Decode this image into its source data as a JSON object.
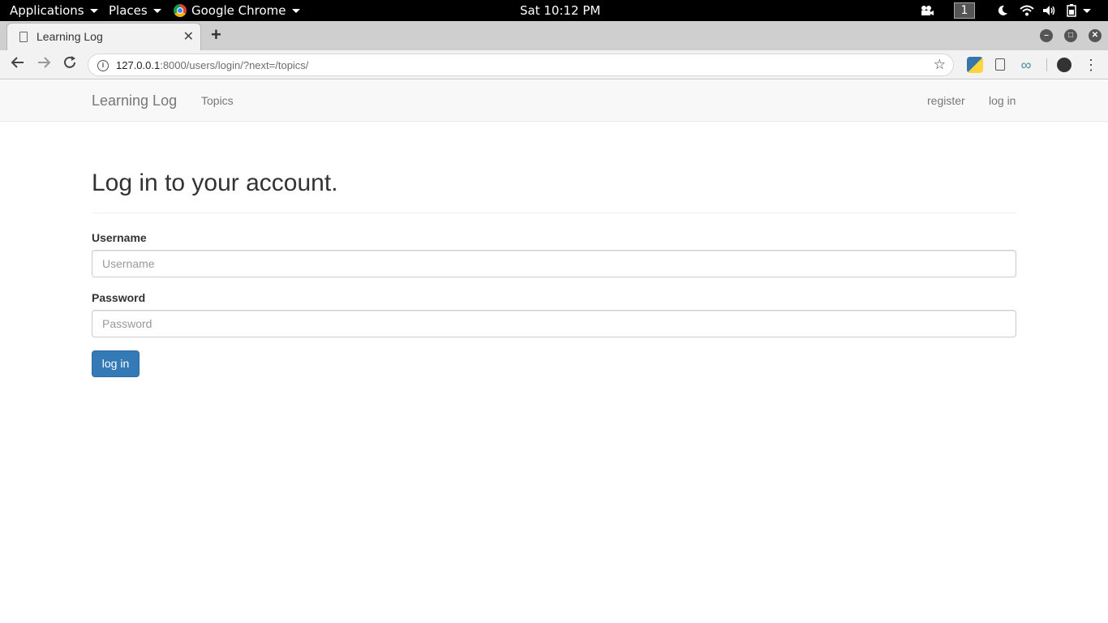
{
  "system_bar": {
    "applications": "Applications",
    "places": "Places",
    "active_app": "Google Chrome",
    "clock": "Sat 10:12 PM",
    "workspace": "1"
  },
  "browser": {
    "tab_title": "Learning Log",
    "new_tab_symbol": "+",
    "url_host": "127.0.0.1",
    "url_rest": ":8000/users/login/?next=/topics/"
  },
  "navbar": {
    "brand": "Learning Log",
    "topics": "Topics",
    "register": "register",
    "login": "log in"
  },
  "form": {
    "heading": "Log in to your account.",
    "username_label": "Username",
    "username_placeholder": "Username",
    "password_label": "Password",
    "password_placeholder": "Password",
    "submit_label": "log in"
  },
  "colors": {
    "primary_button": "#337ab7",
    "navbar_bg": "#f8f8f8",
    "topbar_bg": "#000000"
  }
}
